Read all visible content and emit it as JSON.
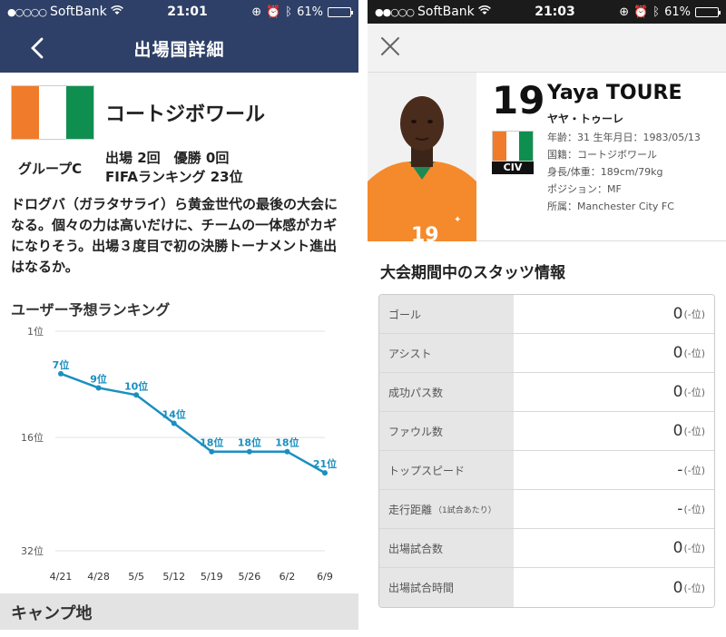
{
  "left": {
    "status": {
      "carrier": "SoftBank",
      "time": "21:01",
      "battery": "61%",
      "battery_level": 0.61
    },
    "nav": {
      "title": "出場国詳細"
    },
    "country": {
      "name": "コートジボワール"
    },
    "group": "グループC",
    "stats": {
      "line1": "出場 2回　優勝 0回",
      "line2": "FIFAランキング 23位"
    },
    "description": "ドログバ（ガラタサライ）ら黄金世代の最後の大会になる。個々の力は高いだけに、チームの一体感がカギになりそう。出場３度目で初の決勝トーナメント進出はなるか。",
    "ranking_title": "ユーザー予想ランキング",
    "camp_title": "キャンプ地"
  },
  "right": {
    "status": {
      "carrier": "SoftBank",
      "time": "21:03",
      "battery": "61%",
      "battery_level": 0.61
    },
    "player": {
      "number": "19",
      "name": "Yaya TOURE",
      "kana": "ヤヤ・トゥーレ",
      "age_line": "年齢：31  生年月日：1983/05/13",
      "nationality": "国籍：コートジボワール",
      "body": "身長/体重：189cm/79kg",
      "position": "ポジション：MF",
      "club": "所属：Manchester City FC",
      "country_code": "CIV"
    },
    "stats_title": "大会期間中のスタッツ情報",
    "stats": [
      {
        "label": "ゴール",
        "note": "",
        "value": "0",
        "unit": "(-位)"
      },
      {
        "label": "アシスト",
        "note": "",
        "value": "0",
        "unit": "(-位)"
      },
      {
        "label": "成功パス数",
        "note": "",
        "value": "0",
        "unit": "(-位)"
      },
      {
        "label": "ファウル数",
        "note": "",
        "value": "0",
        "unit": "(-位)"
      },
      {
        "label": "トップスピード",
        "note": "",
        "value": "-",
        "unit": "(-位)"
      },
      {
        "label": "走行距離",
        "note": "（1試合あたり）",
        "value": "-",
        "unit": "(-位)"
      },
      {
        "label": "出場試合数",
        "note": "",
        "value": "0",
        "unit": "(-位)"
      },
      {
        "label": "出場試合時間",
        "note": "",
        "value": "0",
        "unit": "(-位)"
      }
    ]
  },
  "colors": {
    "navy": "#2e4068",
    "line": "#1a8fc0",
    "orange": "#f07b2b",
    "green": "#0f8f4f"
  },
  "chart_data": {
    "type": "line",
    "title": "ユーザー予想ランキング",
    "categories": [
      "4/21",
      "4/28",
      "5/5",
      "5/12",
      "5/19",
      "5/26",
      "6/2",
      "6/9"
    ],
    "values": [
      7,
      9,
      10,
      14,
      18,
      18,
      18,
      21
    ],
    "point_labels": [
      "7位",
      "9位",
      "10位",
      "14位",
      "18位",
      "18位",
      "18位",
      "21位"
    ],
    "y_ticks": [
      "1位",
      "16位",
      "32位"
    ],
    "ylim": [
      1,
      32
    ],
    "y_inverted": true,
    "grid": true
  }
}
